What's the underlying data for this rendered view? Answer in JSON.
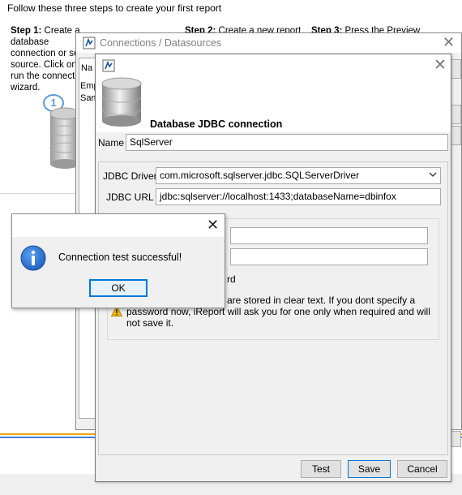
{
  "background": {
    "intro": "Follow these three steps to create your first report",
    "step1": {
      "bold": "Step 1:",
      "lines": [
        "Create a database",
        "connection or se",
        "source. Click on",
        "run the connectio",
        "wizard."
      ]
    },
    "step2": {
      "bold": "Step 2:",
      "text": "Create a new report"
    },
    "step3": {
      "bold": "Step 3:",
      "text": "Press the Preview"
    },
    "step1_number": "1"
  },
  "connections_dialog": {
    "title": "Connections / Datasources",
    "list_header": "Na",
    "rows": [
      "Emp",
      "Sam"
    ]
  },
  "jdbc_dialog": {
    "heading": "Database JDBC connection",
    "name_label": "Name",
    "name_value": "SqlServer",
    "driver_label": "JDBC Driver",
    "driver_value": "com.microsoft.sqlserver.jdbc.SQLServerDriver",
    "url_label": "JDBC URL",
    "url_value": "jdbc:sqlserver://localhost:1433;databaseName=dbinfox",
    "save_password_text": "rd",
    "warning_line1": "are stored in clear text. If you dont specify a",
    "warning_rest": "password now, iReport will ask you for one only when required and will not save it.",
    "buttons": {
      "test": "Test",
      "save": "Save",
      "cancel": "Cancel"
    }
  },
  "message_box": {
    "message": "Connection test successful!",
    "ok": "OK"
  },
  "colors": {
    "accent": "#0078d7",
    "info_blue": "#1f5fbf",
    "warning": "#f2b705"
  }
}
